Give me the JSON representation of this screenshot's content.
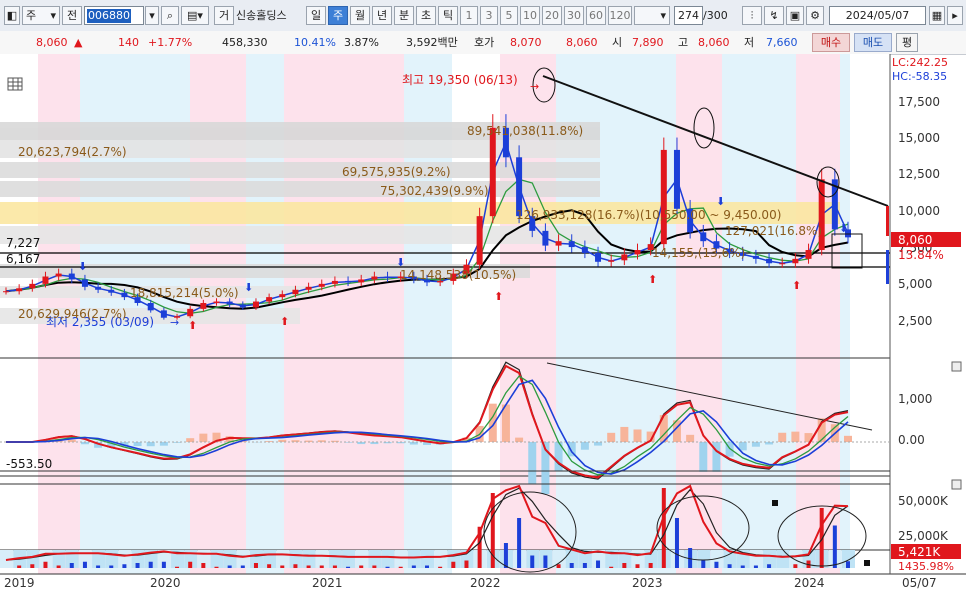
{
  "toolbar": {
    "period_select": "주",
    "mode_select": "전",
    "stock_code": "006880",
    "stock_name": "신송홀딩스",
    "tf_geo": "거",
    "tf_day": "일",
    "tf_week": "주",
    "tf_month": "월",
    "tf_year": "년",
    "tf_min": "분",
    "tf_sec": "초",
    "tf_tick": "틱",
    "intervals": [
      "1",
      "3",
      "5",
      "10",
      "20",
      "30",
      "60",
      "120"
    ],
    "count_current": "274",
    "count_total": "/300",
    "date": "2024/05/07"
  },
  "infobar": {
    "price": "8,060",
    "change_arrow": "▲",
    "change": "140",
    "change_pct": "+1.77%",
    "volume": "458,330",
    "turnover_pct": "10.41%",
    "ratio_pct": "3.87%",
    "amount": "3,592백만",
    "quote_label": "호가",
    "ask": "8,070",
    "bid": "8,060",
    "open_label": "시",
    "open": "7,890",
    "high_label": "고",
    "high": "8,060",
    "low_label": "저",
    "low": "7,660",
    "buy_label": "매수",
    "sell_label": "매도",
    "eval_label": "평"
  },
  "chart_data": [
    {
      "type": "candlestick",
      "panel": "price",
      "y_ticks": [
        "17,500",
        "15,000",
        "12,500",
        "10,000",
        "7,500",
        "5,000",
        "2,500"
      ],
      "ylim": [
        0,
        19700
      ],
      "lc_label": "LC:242.25",
      "hc_label": "HC:-58.35",
      "current_price_tag": "8,060",
      "current_pct_tag": "13.84%",
      "h_lines": [
        "7,227",
        "6,167"
      ],
      "high_annotation": "최고 19,350 (06/13)",
      "low_annotation": "최저 2,355 (03/09)",
      "volume_profile_labels": [
        "89,541,038(11.8%)",
        "20,623,794(2.7%)",
        "69,575,935(9.2%)",
        "75,302,439(9.9%)",
        "126,933,128(16.7%)(10,550.00 ~ 9,450.00)",
        "20,629,946(2.7%)",
        "18,815,214(5.0%)",
        "14,148,538(10.5%)",
        "14,155,(13,6%)",
        "127,021(16.8%)"
      ],
      "x_labels": [
        "2019",
        "2020",
        "2021",
        "2022",
        "2023",
        "2024",
        "05/07"
      ],
      "close_series": [
        4400,
        4600,
        4900,
        5400,
        5600,
        5200,
        4700,
        4500,
        4300,
        4000,
        3600,
        3100,
        2600,
        2700,
        3200,
        3600,
        3700,
        3500,
        3300,
        3700,
        4000,
        4200,
        4500,
        4700,
        4900,
        5100,
        5000,
        5200,
        5400,
        5300,
        5400,
        5200,
        5000,
        5100,
        5600,
        6200,
        9500,
        15500,
        13500,
        9500,
        8500,
        7500,
        7800,
        7400,
        7000,
        6400,
        6500,
        6900,
        7200,
        7600,
        14000,
        10000,
        8400,
        7800,
        7300,
        7000,
        6800,
        6600,
        6300,
        6300,
        6600,
        7200,
        12000,
        8600,
        8060
      ]
    },
    {
      "type": "line",
      "panel": "MACD",
      "y_ticks": [
        "1,000",
        "0.00"
      ],
      "value_label": "-553.50"
    },
    {
      "type": "bar",
      "panel": "volume",
      "y_ticks": [
        "50,000K",
        "25,000K"
      ],
      "value_tag": "5,421K",
      "pct_label": "1435.98%"
    }
  ]
}
